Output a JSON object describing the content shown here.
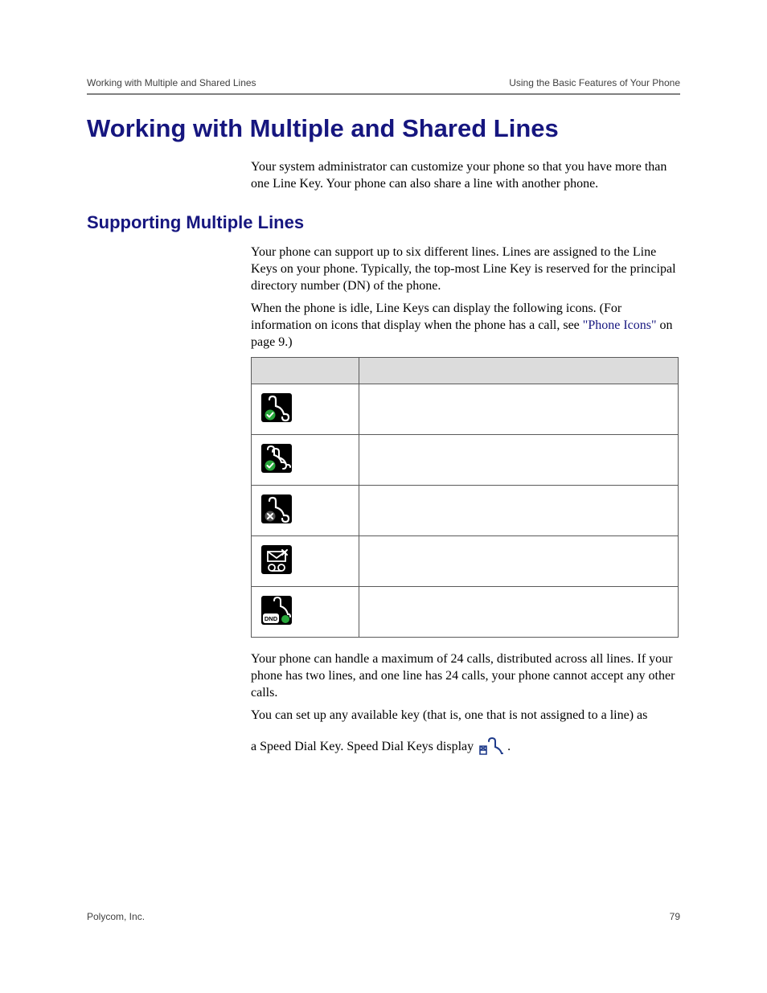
{
  "header": {
    "left": "Working with Multiple and Shared Lines",
    "right": "Using the Basic Features of Your Phone"
  },
  "title": "Working with Multiple and Shared Lines",
  "intro": "Your system administrator can customize your phone so that you have more than one Line Key. Your phone can also share a line with another phone.",
  "subtitle": "Supporting Multiple Lines",
  "para1": "Your phone can support up to six different lines. Lines are assigned to the Line Keys on your phone. Typically, the top-most Line Key is reserved for the principal directory number (DN) of the phone.",
  "para2_a": "When the phone is idle, Line Keys can display the following icons. (For information on icons that display when the phone has a call, see ",
  "para2_link": "\"Phone Icons\"",
  "para2_b": " on page 9.)",
  "icons": [
    {
      "name": "registered-line-icon"
    },
    {
      "name": "registered-shared-line-icon"
    },
    {
      "name": "unregistered-line-icon"
    },
    {
      "name": "voicemail-message-icon"
    },
    {
      "name": "dnd-enabled-line-icon",
      "badge": "DND"
    }
  ],
  "para3": "Your phone can handle a maximum of 24 calls, distributed across all lines. If your phone has two lines, and one line has 24 calls, your phone cannot accept any other calls.",
  "para4": "You can set up any available key (that is, one that is not assigned to a line) as",
  "para5_a": "a Speed Dial Key. Speed Dial Keys display ",
  "para5_b": " .",
  "footer": {
    "left": "Polycom, Inc.",
    "pageno": "79"
  }
}
